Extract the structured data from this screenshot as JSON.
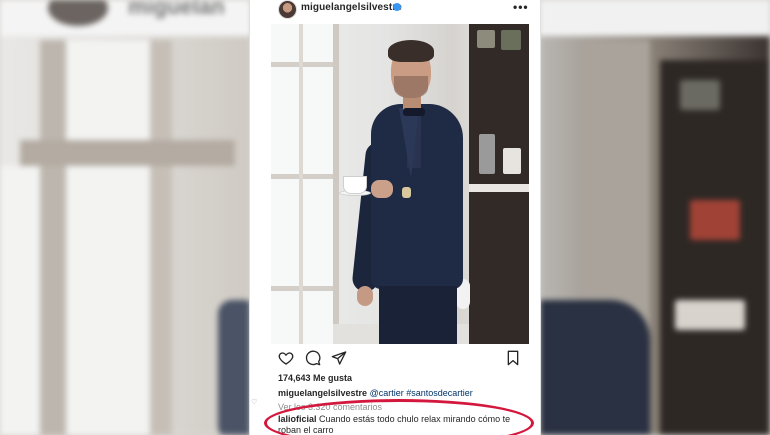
{
  "backdrop": {
    "left_username_partial": "miguelan"
  },
  "post": {
    "username": "miguelangelsilvestre",
    "more_label": "•••",
    "verified": true,
    "likes_text": "174,643 Me gusta",
    "caption": {
      "username": "miguelangelsilvestre",
      "text": "@cartier #santosdecartier"
    },
    "view_comments": "Ver los 3.320 comentarios",
    "comment": {
      "username": "lalioficial",
      "text": "Cuando estás todo chulo relax mirando cómo te roban el carro"
    }
  },
  "icons": {
    "heart": "heart-icon",
    "comment": "comment-icon",
    "share": "share-icon",
    "bookmark": "bookmark-icon",
    "verified": "verified-badge-icon"
  },
  "colors": {
    "highlight": "#d4183d",
    "verified": "#3897f0",
    "text": "#262626",
    "muted": "#8e8e8e"
  }
}
